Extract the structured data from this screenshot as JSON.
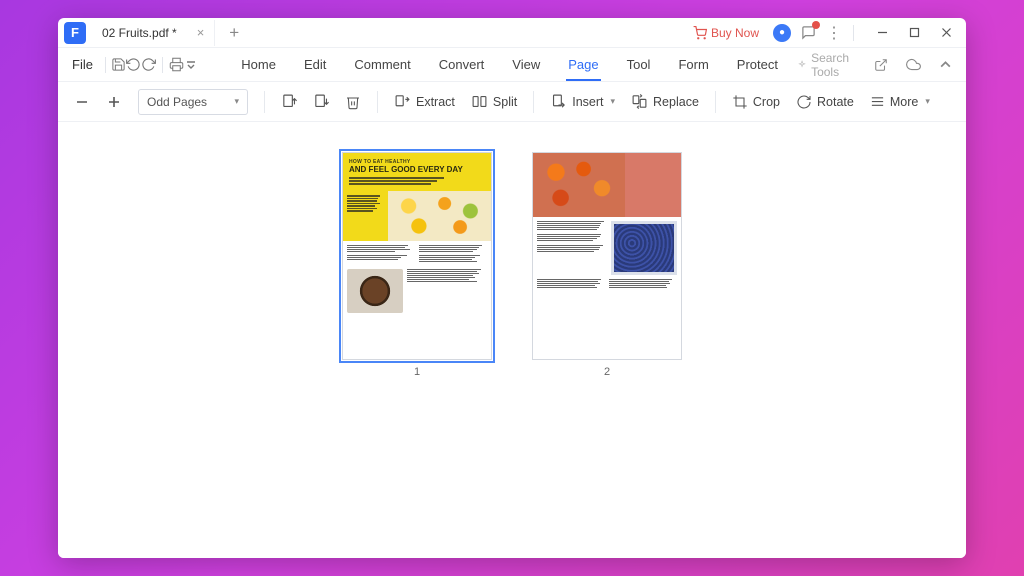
{
  "title_bar": {
    "doc_name": "02 Fruits.pdf *",
    "buy_now": "Buy Now"
  },
  "menu": {
    "file": "File",
    "tabs": [
      "Home",
      "Edit",
      "Comment",
      "Convert",
      "View",
      "Page",
      "Tool",
      "Form",
      "Protect"
    ],
    "active_tab": "Page",
    "search": "Search Tools"
  },
  "toolbar": {
    "page_select": "Odd Pages",
    "extract": "Extract",
    "split": "Split",
    "insert": "Insert",
    "replace": "Replace",
    "crop": "Crop",
    "rotate": "Rotate",
    "more": "More"
  },
  "pages": {
    "p1": {
      "num": "1",
      "sub": "HOW TO EAT HEALTHY",
      "title": "AND FEEL GOOD EVERY DAY"
    },
    "p2": {
      "num": "2"
    }
  }
}
